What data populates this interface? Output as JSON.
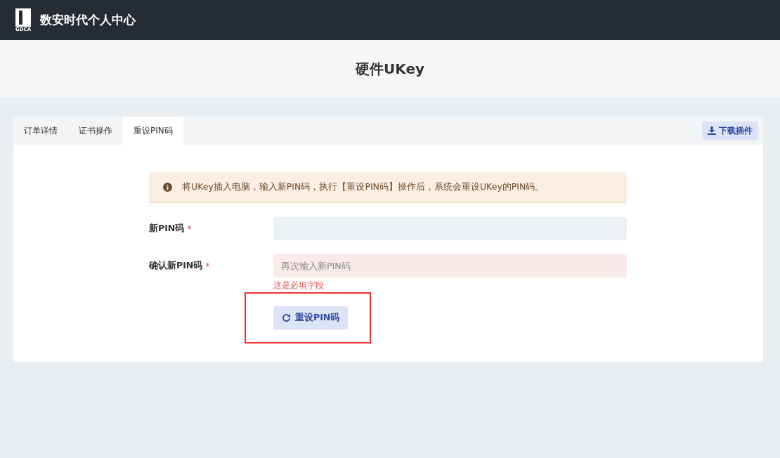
{
  "header": {
    "logo_text": "GDCA",
    "title": "数安时代个人中心"
  },
  "page_title": "硬件UKey",
  "tabs": [
    {
      "label": "订单详情",
      "selected": false
    },
    {
      "label": "证书操作",
      "selected": false
    },
    {
      "label": "重设PIN码",
      "selected": true
    }
  ],
  "download_button": "下载插件",
  "alert": "将UKey插入电脑，输入新PIN码，执行【重设PIN码】操作后，系统会重设UKey的PIN码。",
  "fields": [
    {
      "label": "新PIN码",
      "required_mark": "*",
      "invalid": false
    },
    {
      "label": "确认新PIN码",
      "required_mark": "*",
      "placeholder": "再次输入新PIN码",
      "invalid": true,
      "error": "这是必填字段"
    }
  ],
  "submit_button": {
    "label": "重设PIN码",
    "highlighted": true
  }
}
